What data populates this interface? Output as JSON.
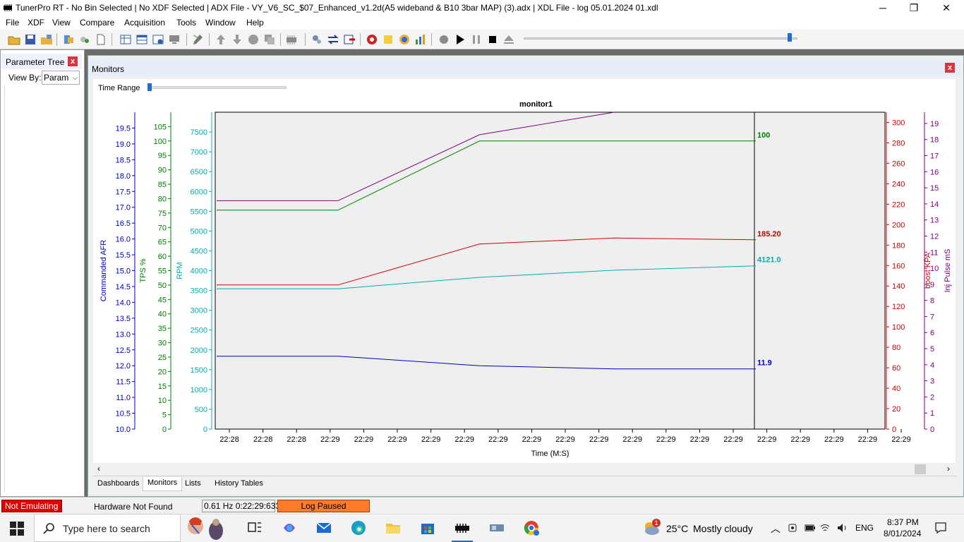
{
  "window": {
    "title": "TunerPro RT - No Bin Selected | No XDF Selected | ADX File - VY_V6_SC_$07_Enhanced_v1.2d(A5 wideband & B10 3bar MAP) (3).adx | XDL File - log 05.01.2024 01.xdl",
    "minimize": "─",
    "restore": "❐",
    "close": "✕"
  },
  "menu": [
    "File",
    "XDF",
    "View",
    "Compare",
    "Acquisition",
    "Tools",
    "Window",
    "Help"
  ],
  "parameter_tree": {
    "title": "Parameter Tree",
    "close": "x",
    "view_by_label": "View By:",
    "view_by_value": "Param"
  },
  "monitors": {
    "title": "Monitors",
    "close": "x",
    "time_range_label": "Time Range"
  },
  "chart_data": {
    "type": "line",
    "title": "monitor1",
    "xlabel": "Time (M:S)",
    "x": [
      "22:28",
      "22:28",
      "22:28",
      "22:29",
      "22:29",
      "22:29",
      "22:29",
      "22:29",
      "22:29",
      "22:29",
      "22:29",
      "22:29",
      "22:29",
      "22:29",
      "22:29",
      "22:29",
      "22:29",
      "22:29",
      "22:29",
      "22:29",
      "22:29"
    ],
    "series": [
      {
        "name": "Commanded AFR",
        "color": "#0000c0",
        "axis": "left1",
        "ylim": [
          10,
          20
        ],
        "ticks": [
          "19.5",
          "19.0",
          "18.5",
          "18.0",
          "17.5",
          "17.0",
          "16.5",
          "16.0",
          "15.5",
          "15.0",
          "14.5",
          "14.0",
          "13.5",
          "13.0",
          "12.5",
          "12.0",
          "11.5",
          "11.0",
          "10.5",
          "10.0"
        ],
        "x_points": [
          0,
          3.6,
          7.8,
          11.8,
          16
        ],
        "y": [
          12.3,
          12.3,
          12.0,
          11.9,
          11.9
        ],
        "end_label": "11.9"
      },
      {
        "name": "TPS %",
        "color": "#008000",
        "axis": "left2",
        "ylim": [
          0,
          110
        ],
        "ticks": [
          "105",
          "100",
          "95",
          "90",
          "85",
          "80",
          "75",
          "70",
          "65",
          "60",
          "55",
          "50",
          "45",
          "40",
          "35",
          "30",
          "25",
          "20",
          "15",
          "10",
          "5",
          "0"
        ],
        "x_points": [
          0,
          3.6,
          7.8,
          16
        ],
        "y": [
          76,
          76,
          100,
          100
        ],
        "end_label": "100"
      },
      {
        "name": "RPM",
        "color": "#00b0b0",
        "axis": "left3",
        "ylim": [
          0,
          8000
        ],
        "ticks": [
          "7500",
          "7000",
          "6500",
          "6000",
          "5500",
          "5000",
          "4500",
          "4000",
          "3500",
          "3000",
          "2500",
          "2000",
          "1500",
          "1000",
          "500",
          "0"
        ],
        "x_points": [
          0,
          3.6,
          7.8,
          11.8,
          16
        ],
        "y": [
          3540,
          3540,
          3830,
          4010,
          4121
        ],
        "end_label": "4121.0"
      },
      {
        "name": "boost KPA",
        "color": "#d00000",
        "axis": "right1",
        "ylim": [
          0,
          310
        ],
        "ticks": [
          "300",
          "280",
          "260",
          "240",
          "220",
          "200",
          "180",
          "160",
          "140",
          "120",
          "100",
          "80",
          "60",
          "40",
          "20",
          "0"
        ],
        "x_points": [
          0,
          3.6,
          7.8,
          11.8,
          16
        ],
        "y": [
          141,
          141,
          181,
          187,
          185.2
        ],
        "end_label": "185.20"
      },
      {
        "name": "Inj Pulse mS",
        "color": "#800080",
        "axis": "right2",
        "ylim": [
          0,
          19.7
        ],
        "ticks": [
          "19",
          "18",
          "17",
          "16",
          "15",
          "14",
          "13",
          "12",
          "11",
          "10",
          "9",
          "8",
          "7",
          "6",
          "5",
          "4",
          "3",
          "2",
          "1",
          "0"
        ],
        "x_points": [
          0,
          3.6,
          7.8,
          11.8
        ],
        "y": [
          14.2,
          14.2,
          18.3,
          19.7
        ],
        "end_label": ""
      }
    ],
    "grid": false,
    "legend": "axis labels"
  },
  "tabs": [
    "Dashboards",
    "Monitors",
    "Lists",
    "History Tables"
  ],
  "status": {
    "emulation": "Not Emulating",
    "hardware": "Hardware Not Found",
    "rate": "0.61 Hz  0:22:29:633",
    "log": "Log Paused"
  },
  "taskbar": {
    "search_placeholder": "Type here to search",
    "weather_temp": "25°C",
    "weather_text": "Mostly cloudy",
    "weather_badge": "1",
    "language": "ENG",
    "time": "8:37 PM",
    "date": "8/01/2024"
  }
}
